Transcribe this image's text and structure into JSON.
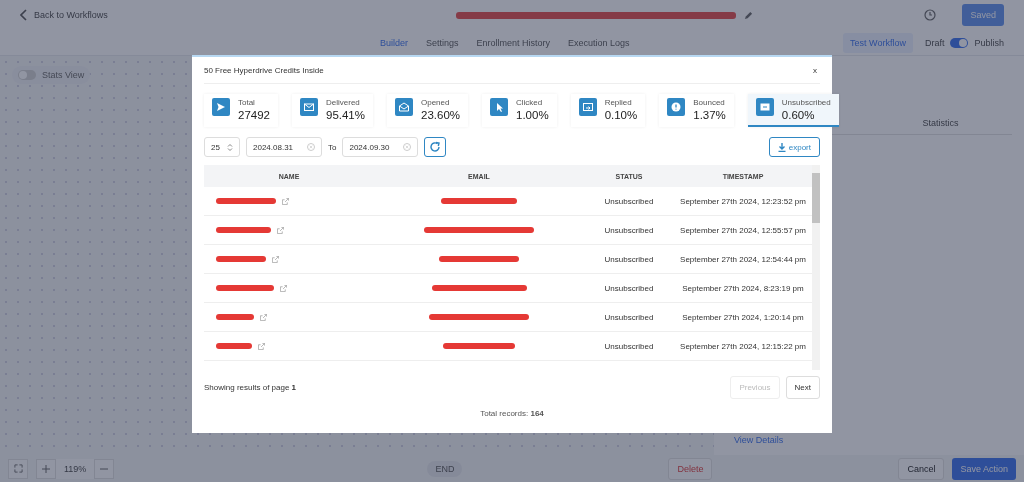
{
  "header": {
    "back_link": "Back to Workflows",
    "save_button": "Saved"
  },
  "nav_tabs": [
    {
      "label": "Builder",
      "selected": true
    },
    {
      "label": "Settings",
      "selected": false
    },
    {
      "label": "Enrollment History",
      "selected": false
    },
    {
      "label": "Execution Logs",
      "selected": false
    }
  ],
  "test_button": "Test Workflow",
  "publish_toggle": {
    "off_label": "Draft",
    "on_label": "Publish",
    "on": true
  },
  "stats_view": {
    "label": "Stats View",
    "on": false
  },
  "canvas": {
    "end_node": "END",
    "zoom": "119%"
  },
  "side_panel": {
    "tab": "Statistics",
    "link": "View Details",
    "delete_button": "Delete",
    "cancel_button": "Cancel",
    "save_button": "Save Action"
  },
  "modal": {
    "title": "50 Free Hyperdrive Credits Inside",
    "close": "x",
    "stats": [
      {
        "kind": "total",
        "label": "Total",
        "value": "27492",
        "selected": false
      },
      {
        "kind": "delivered",
        "label": "Delivered",
        "value": "95.41%",
        "selected": false
      },
      {
        "kind": "opened",
        "label": "Opened",
        "value": "23.60%",
        "selected": false
      },
      {
        "kind": "clicked",
        "label": "Clicked",
        "value": "1.00%",
        "selected": false
      },
      {
        "kind": "replied",
        "label": "Replied",
        "value": "0.10%",
        "selected": false
      },
      {
        "kind": "bounced",
        "label": "Bounced",
        "value": "1.37%",
        "selected": false
      },
      {
        "kind": "unsubscribed",
        "label": "Unsubscribed",
        "value": "0.60%",
        "selected": true
      }
    ],
    "page_size": "25",
    "date_from": "2024.08.31",
    "to_label": "To",
    "date_to": "2024.09.30",
    "export_button": "export",
    "table": {
      "columns": [
        "NAME",
        "EMAIL",
        "STATUS",
        "TIMESTAMP"
      ],
      "rows": [
        {
          "status": "Unsubscribed",
          "timestamp": "September 27th 2024, 12:23:52 pm"
        },
        {
          "status": "Unsubscribed",
          "timestamp": "September 27th 2024, 12:55:57 pm"
        },
        {
          "status": "Unsubscribed",
          "timestamp": "September 27th 2024, 12:54:44 pm"
        },
        {
          "status": "Unsubscribed",
          "timestamp": "September 27th 2024, 8:23:19 pm"
        },
        {
          "status": "Unsubscribed",
          "timestamp": "September 27th 2024, 1:20:14 pm"
        },
        {
          "status": "Unsubscribed",
          "timestamp": "September 27th 2024, 12:15:22 pm"
        }
      ]
    },
    "pagination": {
      "summary": "Showing results of page **1**",
      "previous": {
        "label": "Previous",
        "disabled": true
      },
      "next": "Next"
    },
    "total": "Total records: **164**"
  }
}
